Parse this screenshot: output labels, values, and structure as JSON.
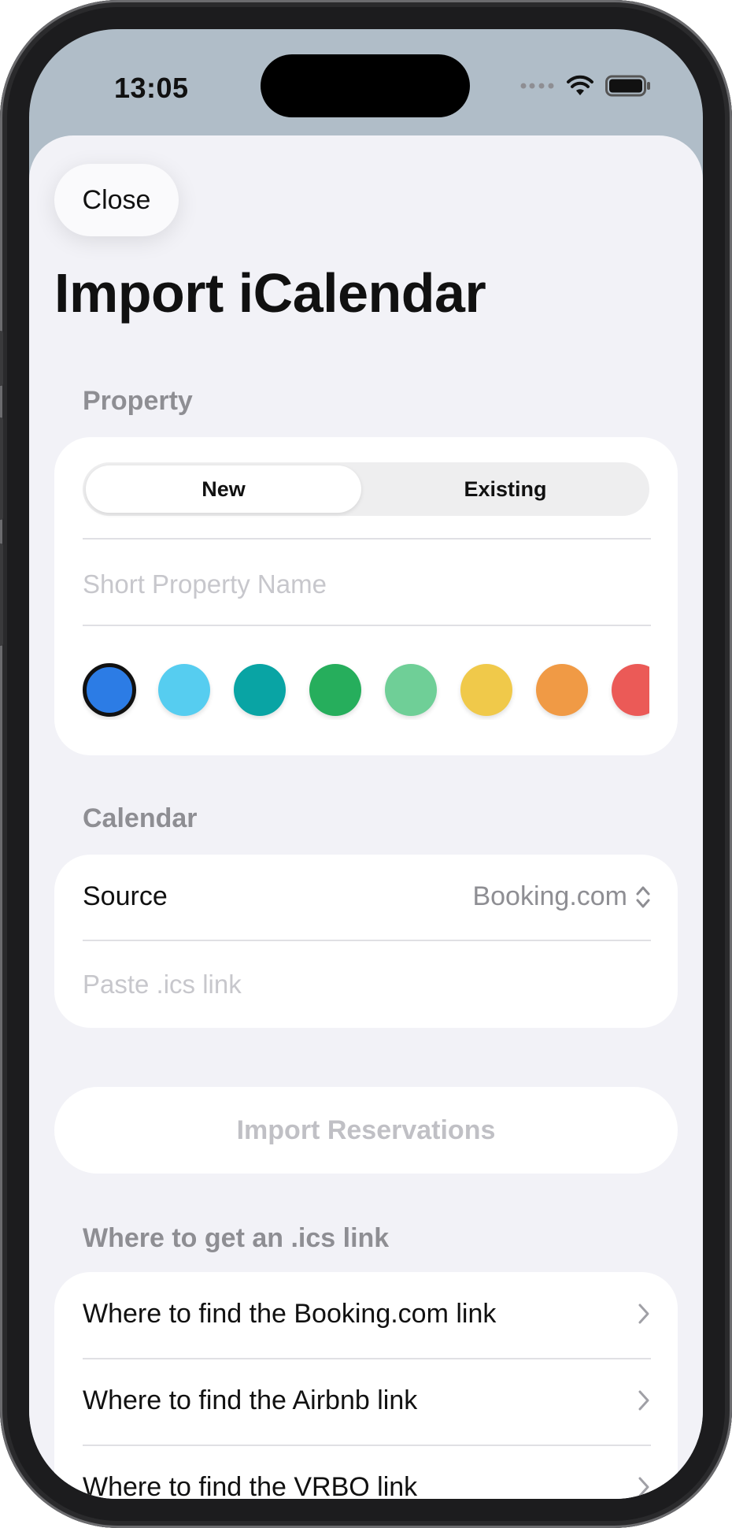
{
  "status_bar": {
    "time": "13:05"
  },
  "close_button": {
    "label": "Close"
  },
  "page_title": "Import iCalendar",
  "property_section": {
    "label": "Property",
    "segments": [
      {
        "label": "New",
        "selected": true
      },
      {
        "label": "Existing",
        "selected": false
      }
    ],
    "name_placeholder": "Short Property Name",
    "colors": [
      "#2c7ce5",
      "#56cdf0",
      "#09a4a4",
      "#26ae5c",
      "#6fcf97",
      "#f0c94a",
      "#f09a45",
      "#eb5a57"
    ],
    "selected_color_index": 0
  },
  "calendar_section": {
    "label": "Calendar",
    "source_label": "Source",
    "source_value": "Booking.com",
    "link_placeholder": "Paste .ics link"
  },
  "import_button": {
    "label": "Import Reservations",
    "enabled": false
  },
  "help_section": {
    "label": "Where to get an .ics link",
    "items": [
      {
        "label": "Where to find the Booking.com link"
      },
      {
        "label": "Where to find the Airbnb link"
      },
      {
        "label": "Where to find the VRBO link"
      }
    ]
  },
  "icons": [
    "signal-dots-icon",
    "wifi-icon",
    "battery-icon",
    "up-down-chevron-icon",
    "chevron-right-icon"
  ]
}
